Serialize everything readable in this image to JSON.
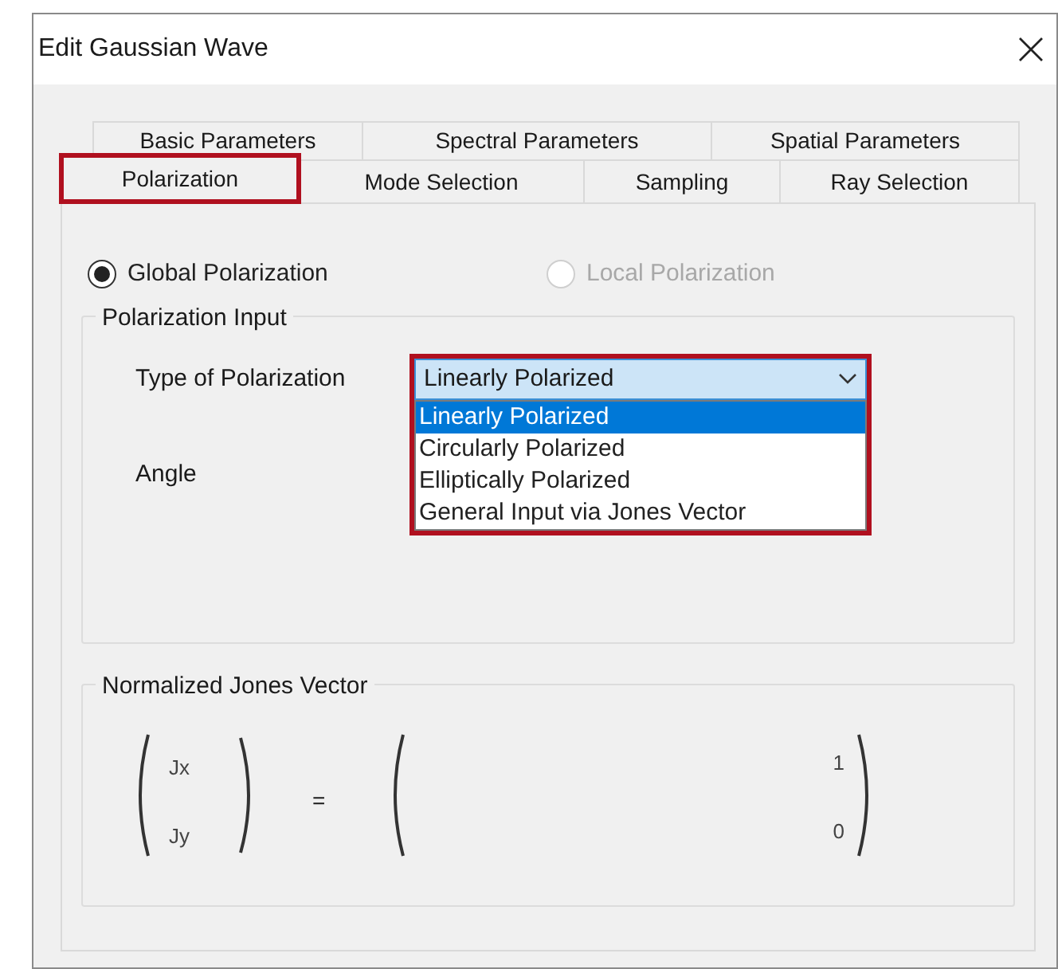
{
  "window": {
    "title": "Edit Gaussian Wave"
  },
  "tab_rows": [
    [
      {
        "label": "Basic Parameters",
        "selected": false,
        "highlighted": false
      },
      {
        "label": "Spectral Parameters",
        "selected": false,
        "highlighted": false
      },
      {
        "label": "Spatial Parameters",
        "selected": false,
        "highlighted": false
      }
    ],
    [
      {
        "label": "Polarization",
        "selected": true,
        "highlighted": true
      },
      {
        "label": "Mode Selection",
        "selected": false,
        "highlighted": false
      },
      {
        "label": "Sampling",
        "selected": false,
        "highlighted": false
      },
      {
        "label": "Ray Selection",
        "selected": false,
        "highlighted": false
      }
    ]
  ],
  "radios": [
    {
      "label": "Global Polarization",
      "selected": true,
      "disabled": false
    },
    {
      "label": "Local Polarization",
      "selected": false,
      "disabled": true
    }
  ],
  "polarization_input": {
    "title": "Polarization Input",
    "type_label": "Type of Polarization",
    "dropdown": {
      "value": "Linearly Polarized",
      "expanded": true,
      "highlighted": true,
      "options": [
        {
          "label": "Linearly Polarized",
          "selected": true
        },
        {
          "label": "Circularly Polarized",
          "selected": false
        },
        {
          "label": "Elliptically Polarized",
          "selected": false
        },
        {
          "label": "General Input via Jones Vector",
          "selected": false
        }
      ]
    },
    "angle_label": "Angle"
  },
  "jones_vector": {
    "title": "Normalized Jones Vector",
    "components": [
      "Jx",
      "Jy"
    ],
    "equals": "=",
    "values": [
      "1",
      "0"
    ]
  }
}
